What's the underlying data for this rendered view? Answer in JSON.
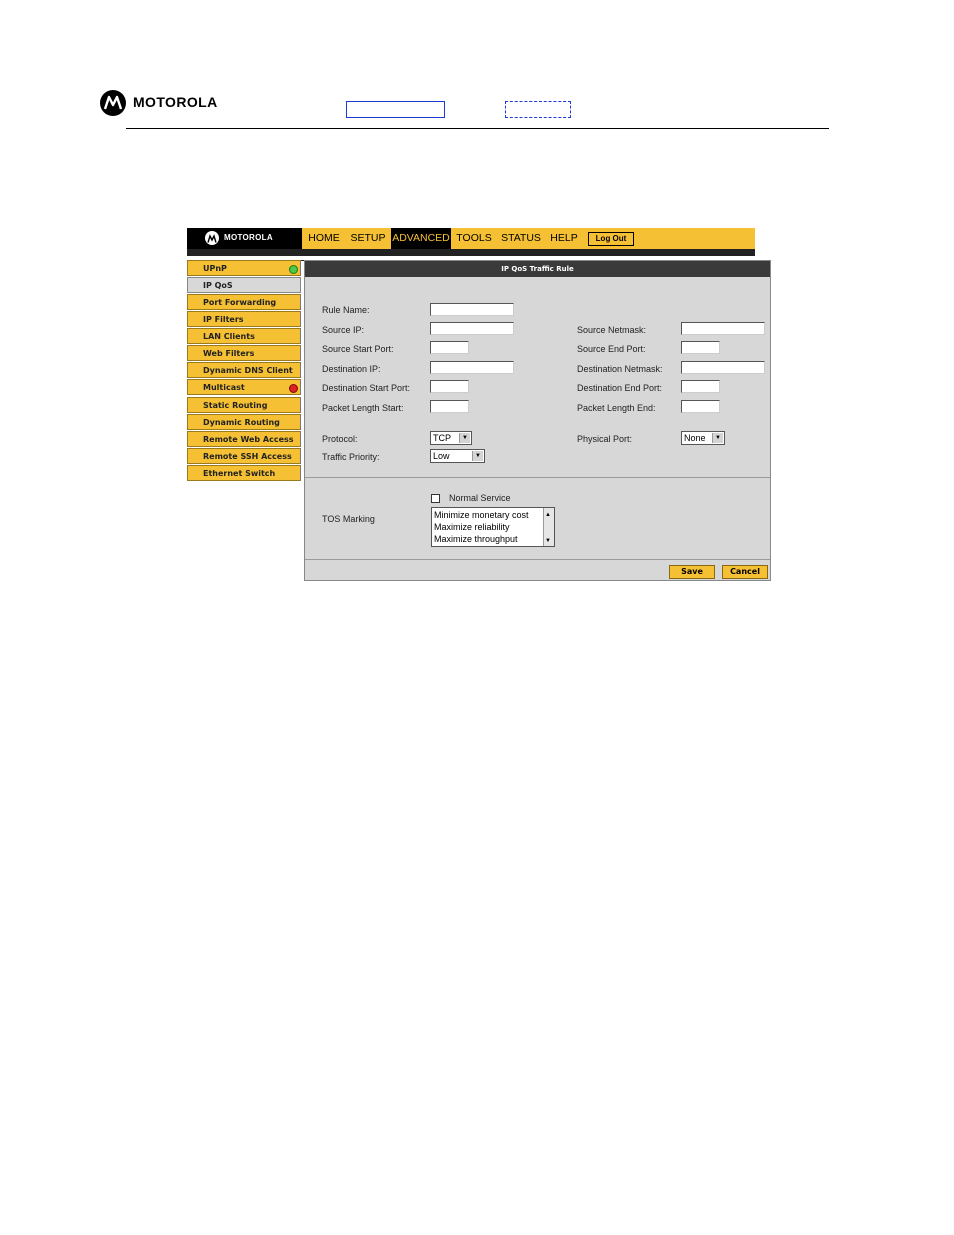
{
  "document": {
    "brand": "MOTOROLA",
    "logo_icon": "motorola-logo-icon"
  },
  "app": {
    "brand": "MOTOROLA",
    "nav": [
      "HOME",
      "SETUP",
      "ADVANCED",
      "TOOLS",
      "STATUS",
      "HELP"
    ],
    "active_nav": "ADVANCED",
    "logout_label": "Log Out",
    "accent_color": "#f5c033"
  },
  "sidebar": {
    "items": [
      {
        "label": "UPnP",
        "indicator": "green-status-icon"
      },
      {
        "label": "IP QoS",
        "selected": true
      },
      {
        "label": "Port Forwarding"
      },
      {
        "label": "IP Filters"
      },
      {
        "label": "LAN Clients"
      },
      {
        "label": "Web Filters"
      },
      {
        "label": "Dynamic DNS Client"
      },
      {
        "label": "Multicast",
        "indicator": "red-status-icon"
      },
      {
        "label": "Static Routing"
      },
      {
        "label": "Dynamic Routing"
      },
      {
        "label": "Remote Web Access"
      },
      {
        "label": "Remote SSH Access"
      },
      {
        "label": "Ethernet Switch"
      }
    ]
  },
  "panel": {
    "title": "IP QoS Traffic Rule",
    "labels": {
      "rule_name": "Rule Name:",
      "source_ip": "Source IP:",
      "source_netmask": "Source Netmask:",
      "source_start_port": "Source Start Port:",
      "source_end_port": "Source End Port:",
      "dest_ip": "Destination IP:",
      "dest_netmask": "Destination Netmask:",
      "dest_start_port": "Destination Start Port:",
      "dest_end_port": "Destination End Port:",
      "pkt_len_start": "Packet Length Start:",
      "pkt_len_end": "Packet Length End:",
      "protocol": "Protocol:",
      "physical_port": "Physical Port:",
      "traffic_priority": "Traffic Priority:",
      "tos_marking": "TOS Marking"
    },
    "values": {
      "protocol": "TCP",
      "physical_port": "None",
      "traffic_priority": "Low"
    },
    "normal_service": "Normal Service",
    "tos_options": [
      "Minimize monetary cost",
      "Maximize reliability",
      "Maximize throughput"
    ],
    "save_label": "Save",
    "cancel_label": "Cancel"
  }
}
